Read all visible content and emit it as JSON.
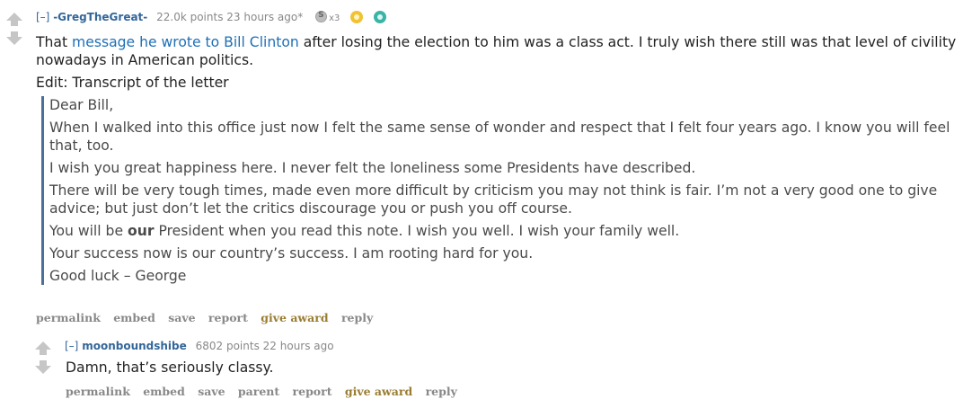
{
  "comment1": {
    "expand": "[–]",
    "author": "-GregTheGreat-",
    "score": "22.0k points",
    "time": "23 hours ago*",
    "silver_count": "x3",
    "text_pre": "That ",
    "link_text": "message he wrote to Bill Clinton",
    "text_post": " after losing the election to him was a class act. I truly wish there still was that level of civility nowadays in American politics.",
    "edit_line": "Edit: Transcript of the letter",
    "letter": {
      "salutation": "Dear Bill,",
      "p1": "When I walked into this office just now I felt the same sense of wonder and respect that I felt four years ago. I know you will feel that, too.",
      "p2": "I wish you great happiness here. I never felt the loneliness some Presidents have described.",
      "p3": "There will be very tough times, made even more difficult by criticism you may not think is fair. I’m not a very good one to give advice; but just don’t let the critics discourage you or push you off course.",
      "p4_pre": "You will be ",
      "p4_bold": "our",
      "p4_post": " President when you read this note. I wish you well. I wish your family well.",
      "p5": "Your success now is our country’s success. I am rooting hard for you.",
      "signoff": "Good luck – George"
    },
    "buttons": {
      "permalink": "permalink",
      "embed": "embed",
      "save": "save",
      "report": "report",
      "give_award": "give award",
      "reply": "reply"
    }
  },
  "comment2": {
    "expand": "[–]",
    "author": "moonboundshibe",
    "score": "6802 points",
    "time": "22 hours ago",
    "text": "Damn, that’s seriously classy.",
    "buttons": {
      "permalink": "permalink",
      "embed": "embed",
      "save": "save",
      "parent": "parent",
      "report": "report",
      "give_award": "give award",
      "reply": "reply"
    }
  },
  "icons": {
    "upvote": "upvote-arrow-icon",
    "downvote": "downvote-arrow-icon",
    "silver": "silver-award-icon",
    "gold": "gold-award-icon",
    "platinum": "platinum-award-icon"
  },
  "colors": {
    "author": "#336699",
    "link": "#1f6fb5",
    "quote_border": "#4a6f9b",
    "give_award": "#9a7d32",
    "meta": "#888888"
  }
}
